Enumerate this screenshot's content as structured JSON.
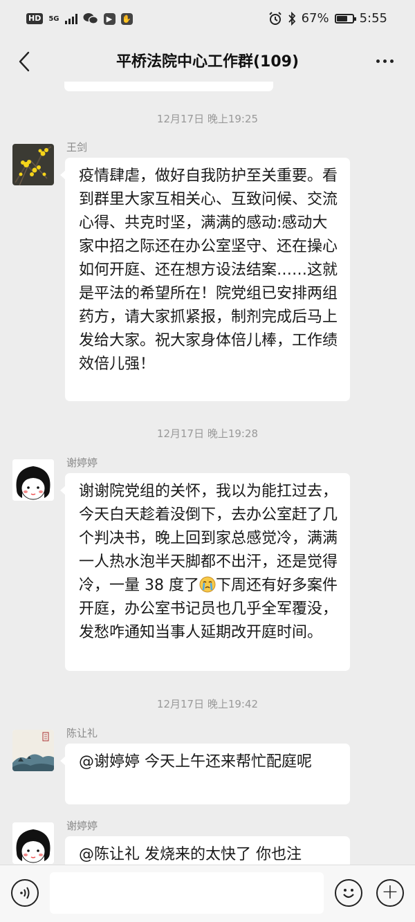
{
  "status_bar": {
    "network_hd": "HD",
    "network_5g": "5G",
    "battery_percent": "67%",
    "battery_level": 0.67,
    "time": "5:55",
    "icons": [
      "hd-icon",
      "signal-icon",
      "wechat-icon",
      "app-icon",
      "app-icon",
      "alarm-icon",
      "bluetooth-icon",
      "battery-icon"
    ]
  },
  "header": {
    "title": "平桥法院中心工作群(109)",
    "back_icon": "chevron-left-icon",
    "more_icon": "more-dots-icon"
  },
  "messages": [
    {
      "timestamp": "12月17日 晚上19:25",
      "sender": "王剑",
      "text": "疫情肆虐，做好自我防护至关重要。看到群里大家互相关心、互致问候、交流心得、共克时坚，满满的感动:感动大家中招之际还在办公室坚守、还在操心如何开庭、还在想方设法结案……这就是平法的希望所在！院党组已安排两组药方，请大家抓紧报，制剂完成后马上发给大家。祝大家身体倍儿棒，工作绩效倍儿强！"
    },
    {
      "timestamp": "12月17日 晚上19:28",
      "sender": "谢婷婷",
      "text_before_emoji": "谢谢院党组的关怀，我以为能扛过去，今天白天趁着没倒下，去办公室赶了几个判决书，晚上回到家总感觉冷，满满一人热水泡半天脚都不出汗，还是觉得冷，一量 38 度了",
      "emoji": "crying-emoji-icon",
      "text_after_emoji": "下周还有好多案件开庭，办公室书记员也几乎全军覆没，发愁咋通知当事人延期改开庭时间。"
    },
    {
      "timestamp": "12月17日 晚上19:42",
      "sender": "陈让礼",
      "text": "@谢婷婷  今天上午还来帮忙配庭呢"
    },
    {
      "sender": "谢婷婷",
      "text": "@陈让礼  发烧来的太快了 你也注"
    }
  ],
  "input_bar": {
    "voice_icon": "voice-icon",
    "emoji_icon": "emoji-icon",
    "plus_icon": "plus-icon"
  }
}
